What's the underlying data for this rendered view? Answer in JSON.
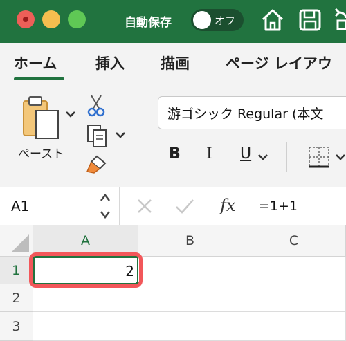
{
  "titlebar": {
    "autosave_label": "自動保存",
    "autosave_state": "オフ",
    "icons": [
      "close-button",
      "minimize-button",
      "maximize-button",
      "home-icon",
      "save-icon",
      "undo-icon"
    ]
  },
  "tabs": {
    "home": "ホーム",
    "insert": "挿入",
    "draw": "描画",
    "page_layout": "ページ レイアウ"
  },
  "ribbon": {
    "paste_label": "ペースト",
    "font_name": "游ゴシック Regular (本文",
    "bold": "B",
    "italic": "I",
    "underline": "U"
  },
  "formula_bar": {
    "name_box": "A1",
    "fx": "fx",
    "formula": "=1+1"
  },
  "grid": {
    "columns": [
      "A",
      "B",
      "C"
    ],
    "rows": [
      "1",
      "2",
      "3"
    ],
    "cells": {
      "A1": "2"
    }
  },
  "colors": {
    "title_green": "#21733F",
    "highlight_red": "#F2575A",
    "active_header_text": "#21733F"
  }
}
